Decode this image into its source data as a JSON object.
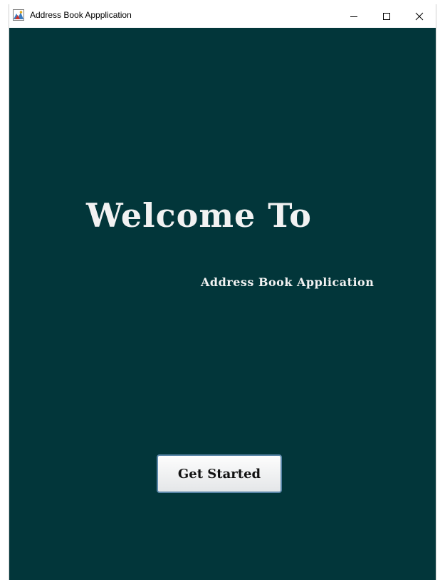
{
  "window": {
    "title": "Address Book Appplication",
    "icon": "app-icon",
    "controls": {
      "minimize_icon": "minimize-icon",
      "maximize_icon": "maximize-icon",
      "close_icon": "close-icon"
    }
  },
  "main": {
    "heading": "Welcome To",
    "subtitle": "Address Book Application",
    "start_button_label": "Get Started"
  },
  "colors": {
    "background": "#02363a",
    "text": "#f2f2f2",
    "button_border": "#5a86a8"
  }
}
